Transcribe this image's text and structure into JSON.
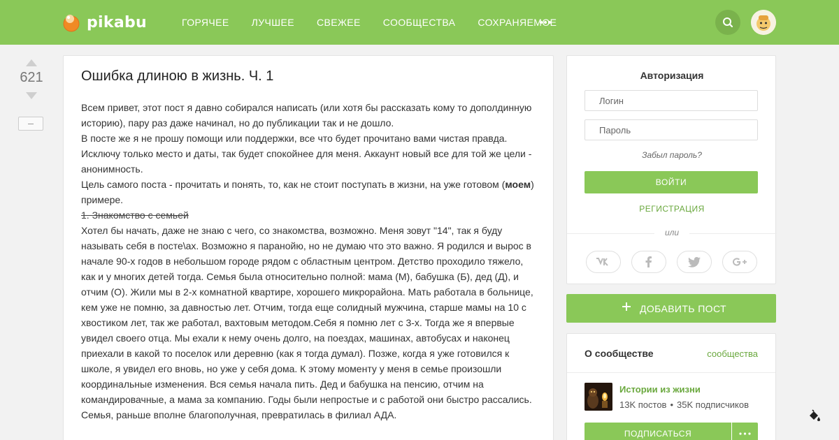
{
  "header": {
    "logo_text": "pikabu",
    "nav": [
      "ГОРЯЧЕЕ",
      "ЛУЧШЕЕ",
      "СВЕЖЕЕ",
      "СООБЩЕСТВА",
      "СОХРАНЯЕМОЕ"
    ],
    "accent_color": "#8ac858"
  },
  "post": {
    "rating": "621",
    "title": "Ошибка длиною в жизнь. Ч. 1",
    "p1": "Всем привет, этот пост я давно собирался написать (или хотя бы рассказать кому то дополдинную историю), пару раз даже начинал, но до публикации так и не дошло.",
    "p2": "В посте же я не прошу помощи или поддержки, все что будет прочитано вами чистая правда. Исключу только место и даты, так будет спокойнее для меня. Аккаунт новый все для той же цели - анонимность.",
    "p3_before": "Цель самого поста - прочитать и понять, то, как не стоит поступать в жизни, на уже готовом (",
    "p3_bold": "моем",
    "p3_after": ") примере.",
    "strike": "1. Знакомство с семьей",
    "p4": "Хотел бы начать, даже не знаю с чего, со знакомства, возможно. Меня зовут \"14\", так я буду называть себя в посте\\ах. Возможно я паранойю, но не думаю что это важно. Я родился и вырос в начале 90-х годов в небольшом городе рядом с областным центром. Детство проходило тяжело, как и у многих детей тогда. Семья была относительно полной: мама (М), бабушка (Б), дед (Д), и отчим (О). Жили мы в 2-х комнатной квартире, хорошего микрорайона. Мать работала в больнице, кем уже не помню, за давностью лет. Отчим, тогда еще солидный мужчина, старше мамы на 10 с хвостиком лет, так же работал, вахтовым методом.Себя я помню лет с 3-х. Тогда же я впервые увидел своего отца. Мы ехали к нему очень долго, на поездах, машинах, автобусах и наконец приехали в какой то поселок или деревню (как я тогда думал). Позже, когда я уже готовился к школе, я увидел его вновь, но уже у себя дома. К этому моменту у меня в семье произошли координальные изменения. Вся семья начала пить. Дед и бабушка на пенсию, отчим на командировачные, а мама за компанию. Годы были непростые и с работой они быстро рассались. Семья, раньше вполне благополучная, превратилась в филиал АДА."
  },
  "auth": {
    "title": "Авторизация",
    "login_placeholder": "Логин",
    "password_placeholder": "Пароль",
    "forgot": "Забыл пароль?",
    "login_button": "ВОЙТИ",
    "register": "РЕГИСТРАЦИЯ",
    "or": "или",
    "social": [
      "vk-icon",
      "facebook-icon",
      "twitter-icon",
      "google-plus-icon"
    ]
  },
  "add_post": "ДОБАВИТЬ ПОСТ",
  "community": {
    "title": "О сообществе",
    "link": "сообщества",
    "name": "Истории из жизни",
    "posts": "13K постов",
    "subscribers": "35K подписчиков",
    "dot": "•",
    "subscribe": "ПОДПИСАТЬСЯ"
  }
}
